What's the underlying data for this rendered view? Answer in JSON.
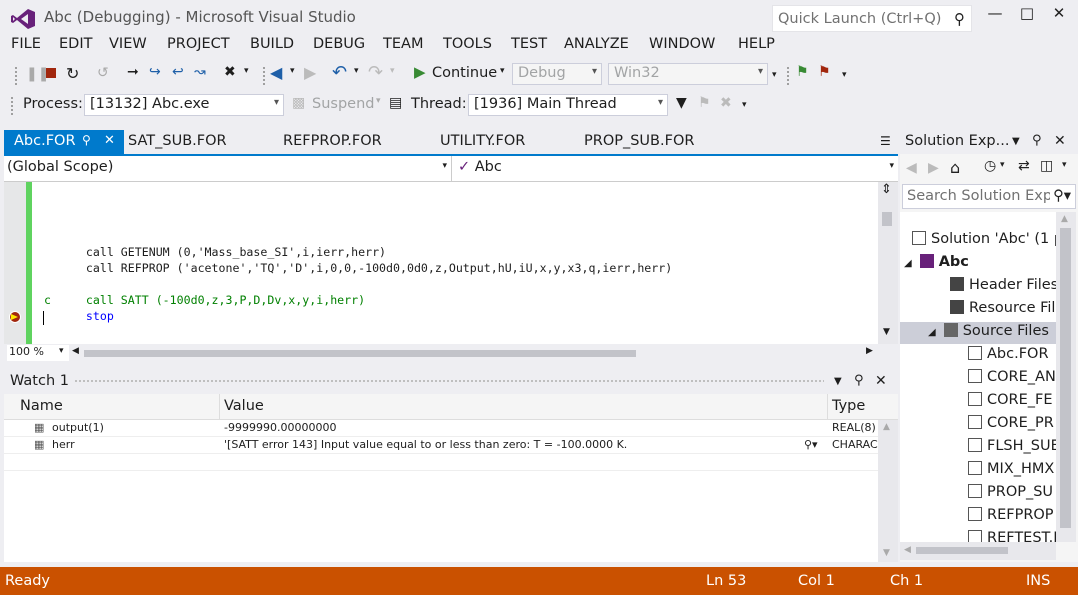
{
  "window": {
    "title": "Abc (Debugging) - Microsoft Visual Studio",
    "quick_launch_placeholder": "Quick Launch (Ctrl+Q)"
  },
  "menu": [
    "FILE",
    "EDIT",
    "VIEW",
    "PROJECT",
    "BUILD",
    "DEBUG",
    "TEAM",
    "TOOLS",
    "TEST",
    "ANALYZE",
    "WINDOW",
    "HELP"
  ],
  "toolbar": {
    "continue_label": "Continue",
    "configuration": "Debug",
    "platform": "Win32",
    "process_label": "Process:",
    "process_value": "[13132]  Abc.exe",
    "suspend_label": "Suspend",
    "thread_label": "Thread:",
    "thread_value": "[1936] Main Thread"
  },
  "doc_tabs": [
    "Abc.FOR",
    "SAT_SUB.FOR",
    "REFPROP.FOR",
    "UTILITY.FOR",
    "PROP_SUB.FOR"
  ],
  "navbar": {
    "scope": "(Global Scope)",
    "member": "Abc"
  },
  "editor": {
    "lines": [
      "call GETENUM (0,'Mass_base_SI',i,ierr,herr)",
      "call REFPROP ('acetone','TQ','D',i,0,0,-100d0,0d0,z,Output,hU,iU,x,y,x3,q,ierr,herr)",
      "call SATT (-100d0,z,3,P,D,Dv,x,y,i,herr)",
      "stop"
    ],
    "comment_marker": "c",
    "zoom": "100 %"
  },
  "watch": {
    "title": "Watch 1",
    "columns": [
      "Name",
      "Value",
      "Type"
    ],
    "rows": [
      {
        "name": "output(1)",
        "value": "-9999990.00000000",
        "type": "REAL(8)"
      },
      {
        "name": "herr",
        "value": "'[SATT error 143] Input value equal to or less than zero: T = -100.0000 K.",
        "type": "CHARAC"
      }
    ]
  },
  "solution_explorer": {
    "title": "Solution Exp...",
    "search_placeholder": "Search Solution Exp",
    "tree": [
      {
        "label": "Solution 'Abc' (1 p",
        "level": 0,
        "icon": "solution-icon"
      },
      {
        "label": "Abc",
        "level": 1,
        "icon": "fortran-project-icon",
        "bold": true
      },
      {
        "label": "Header Files",
        "level": 2,
        "icon": "folder-icon"
      },
      {
        "label": "Resource Fil",
        "level": 2,
        "icon": "folder-icon"
      },
      {
        "label": "Source Files",
        "level": 2,
        "icon": "folder-open-icon"
      },
      {
        "label": "Abc.FOR",
        "level": 3,
        "icon": "file-icon"
      },
      {
        "label": "CORE_AN",
        "level": 3,
        "icon": "file-icon"
      },
      {
        "label": "CORE_FE",
        "level": 3,
        "icon": "file-icon"
      },
      {
        "label": "CORE_PR",
        "level": 3,
        "icon": "file-icon"
      },
      {
        "label": "FLSH_SUE",
        "level": 3,
        "icon": "file-icon"
      },
      {
        "label": "MIX_HMX",
        "level": 3,
        "icon": "file-icon"
      },
      {
        "label": "PROP_SU",
        "level": 3,
        "icon": "file-icon"
      },
      {
        "label": "REFPROP",
        "level": 3,
        "icon": "file-icon"
      },
      {
        "label": "REFTEST.F",
        "level": 3,
        "icon": "file-icon"
      }
    ]
  },
  "status": {
    "state": "Ready",
    "line": "Ln 53",
    "col": "Col 1",
    "ch": "Ch 1",
    "mode": "INS"
  },
  "colors": {
    "accent": "#007acc",
    "status_debug": "#ca5100",
    "change_bar": "#5fd35f"
  }
}
